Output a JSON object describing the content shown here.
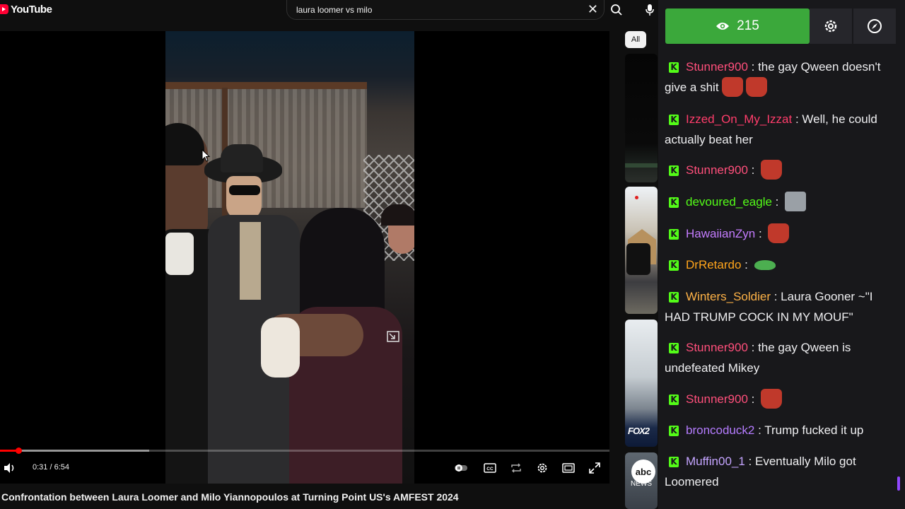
{
  "youtube": {
    "logo_text": "YouTube",
    "search_query": "laura loomer vs milo"
  },
  "player": {
    "time": "0:31 / 6:54",
    "progress": 0.075,
    "buffered": 0.245,
    "video_title": "Confrontation between Laura Loomer and Milo Yiannopoulos at Turning Point US's AMFEST 2024"
  },
  "related": {
    "chip_all": "All",
    "fox_label": "FOX2",
    "abc_label": "abc",
    "abc_news": "NEWS"
  },
  "chat": {
    "viewer_count": "215",
    "badge_letter": "K",
    "messages": [
      {
        "user": "Stunner900",
        "color": "#ff4f7b",
        "text": "the gay Qween doesn't give a shit",
        "emotes": 2
      },
      {
        "user": "Izzed_On_My_Izzat",
        "color": "#ff3d6b",
        "text": "Well, he could actually beat her",
        "emotes": 0
      },
      {
        "user": "Stunner900",
        "color": "#ff4f7b",
        "text": "",
        "emotes": 1
      },
      {
        "user": "devoured_eagle",
        "color": "#53fc18",
        "text": "",
        "emotes": 1
      },
      {
        "user": "HawaiianZyn",
        "color": "#c47cff",
        "text": "",
        "emotes": 1
      },
      {
        "user": "DrRetardo",
        "color": "#ffa41b",
        "text": "",
        "emotes": 1
      },
      {
        "user": "Winters_Soldier",
        "color": "#ffb347",
        "text": "Laura Gooner ~\"I HAD TRUMP COCK IN MY MOUF\"",
        "emotes": 0
      },
      {
        "user": "Stunner900",
        "color": "#ff4f7b",
        "text": "the gay Qween is undefeated Mikey",
        "emotes": 0
      },
      {
        "user": "Stunner900",
        "color": "#ff4f7b",
        "text": "",
        "emotes": 1
      },
      {
        "user": "broncoduck2",
        "color": "#b57cff",
        "text": "Trump fucked it up",
        "emotes": 0
      },
      {
        "user": "Muffin00_1",
        "color": "#c4a4ff",
        "text": "Eventually Milo got Loomered",
        "emotes": 0
      }
    ]
  }
}
